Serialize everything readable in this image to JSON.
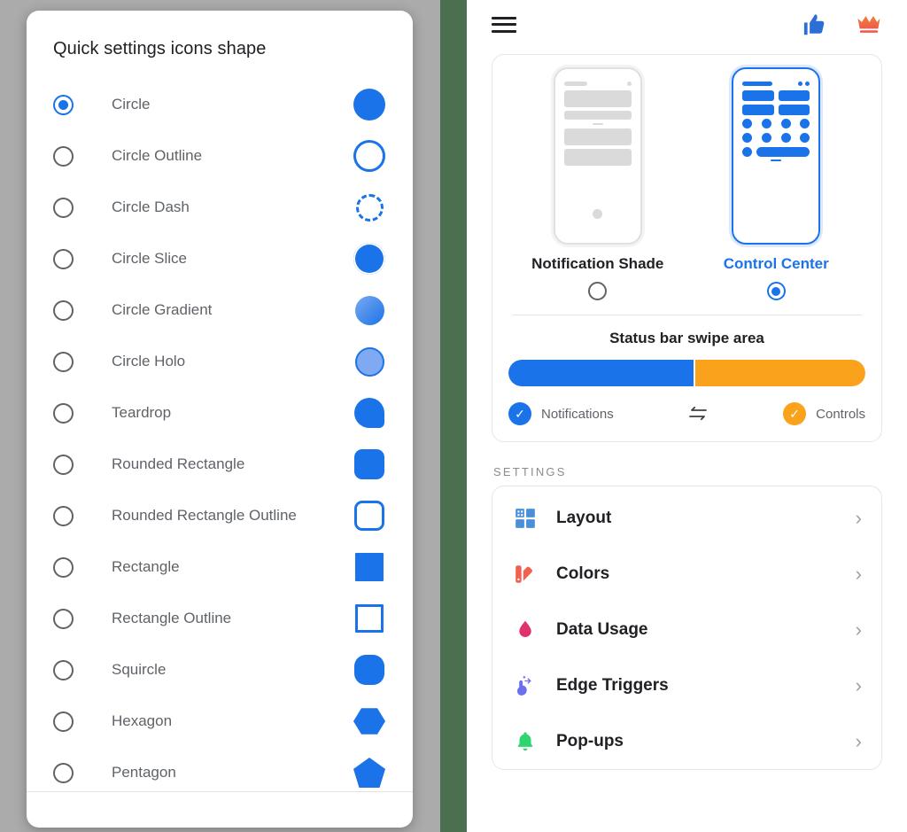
{
  "dialog": {
    "title": "Quick settings icons shape",
    "options": [
      {
        "label": "Circle",
        "shape": "circle",
        "selected": true
      },
      {
        "label": "Circle Outline",
        "shape": "circle-outline",
        "selected": false
      },
      {
        "label": "Circle Dash",
        "shape": "circle-dash",
        "selected": false
      },
      {
        "label": "Circle Slice",
        "shape": "circle-slice",
        "selected": false
      },
      {
        "label": "Circle Gradient",
        "shape": "circle-gradient",
        "selected": false
      },
      {
        "label": "Circle Holo",
        "shape": "circle-holo",
        "selected": false
      },
      {
        "label": "Teardrop",
        "shape": "teardrop",
        "selected": false
      },
      {
        "label": "Rounded Rectangle",
        "shape": "round-rect",
        "selected": false
      },
      {
        "label": "Rounded Rectangle Outline",
        "shape": "round-rect-outline",
        "selected": false
      },
      {
        "label": "Rectangle",
        "shape": "rect",
        "selected": false
      },
      {
        "label": "Rectangle Outline",
        "shape": "rect-outline",
        "selected": false
      },
      {
        "label": "Squircle",
        "shape": "squircle",
        "selected": false
      },
      {
        "label": "Hexagon",
        "shape": "hexagon",
        "selected": false
      },
      {
        "label": "Pentagon",
        "shape": "pentagon",
        "selected": false
      }
    ]
  },
  "topbar": {
    "menu_icon": "hamburger-menu-icon",
    "thumbs_up_icon": "thumbs-up-icon",
    "crown_icon": "crown-icon"
  },
  "style_card": {
    "choices": [
      {
        "caption": "Notification Shade",
        "selected": false
      },
      {
        "caption": "Control Center",
        "selected": true
      }
    ],
    "swipe": {
      "title": "Status bar swipe area",
      "left_percent": 52,
      "right_percent": 48,
      "left_label": "Notifications",
      "right_label": "Controls",
      "swap_icon": "swap-arrows-icon",
      "check_glyph": "✓"
    }
  },
  "settings": {
    "header": "SETTINGS",
    "items": [
      {
        "label": "Layout",
        "icon": "grid-layout-icon",
        "chevron": "›"
      },
      {
        "label": "Colors",
        "icon": "color-palette-icon",
        "chevron": "›"
      },
      {
        "label": "Data Usage",
        "icon": "water-drop-icon",
        "chevron": "›"
      },
      {
        "label": "Edge Triggers",
        "icon": "tap-gesture-icon",
        "chevron": "›"
      },
      {
        "label": "Pop-ups",
        "icon": "bell-icon",
        "chevron": "›"
      }
    ]
  },
  "colors": {
    "accent_blue": "#1a73e8",
    "accent_orange": "#faa21b",
    "scrim_gray": "#ababab",
    "backdrop_green": "#4a7050",
    "layout_icon": "#4a90d9",
    "colors_icon": "#f2604f",
    "data_usage_icon": "#e0336b",
    "edge_triggers_icon": "#6c6ff0",
    "popups_icon": "#2fd56e",
    "crown_icon": "#f06c3a",
    "thumbs_up_icon": "#2b6fd6"
  }
}
